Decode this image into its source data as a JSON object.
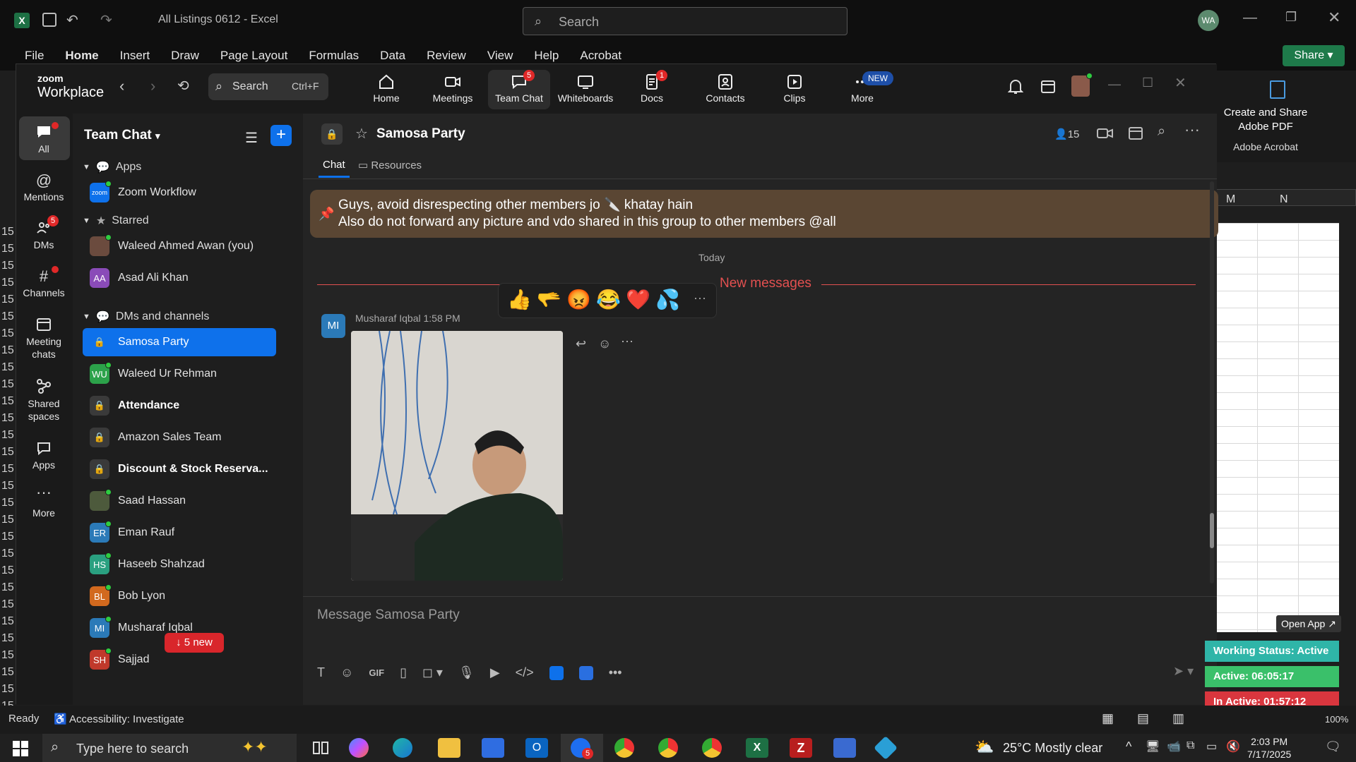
{
  "excel": {
    "title": "All Listings 0612 - Excel",
    "search_placeholder": "Search",
    "user_initials": "WA",
    "tabs": [
      "File",
      "Home",
      "Insert",
      "Draw",
      "Page Layout",
      "Formulas",
      "Data",
      "Review",
      "View",
      "Help",
      "Acrobat"
    ],
    "share_label": "Share",
    "acrobat_create": "Create and Share Adobe PDF",
    "acrobat_group": "Adobe Acrobat",
    "columns": [
      "M",
      "N"
    ],
    "row_prefix": "15",
    "status_ready": "Ready",
    "accessibility": "Accessibility: Investigate",
    "zoom_level": "100%",
    "open_app": "Open App ↗",
    "working_status": "Working Status: Active",
    "active_time": "Active: 06:05:17",
    "inactive_time": "In Active: 01:57:12"
  },
  "zoom": {
    "logo_top": "zoom",
    "logo_bottom": "Workplace",
    "search_label": "Search",
    "search_shortcut": "Ctrl+F",
    "top_tabs": [
      {
        "label": "Home",
        "icon": "home-icon"
      },
      {
        "label": "Meetings",
        "icon": "video-icon"
      },
      {
        "label": "Team Chat",
        "icon": "chat-icon",
        "badge": "5"
      },
      {
        "label": "Whiteboards",
        "icon": "whiteboard-icon"
      },
      {
        "label": "Docs",
        "icon": "docs-icon",
        "badge": "1"
      },
      {
        "label": "Contacts",
        "icon": "contacts-icon"
      },
      {
        "label": "Clips",
        "icon": "clips-icon"
      },
      {
        "label": "More",
        "icon": "more-icon",
        "badge_new": "NEW"
      }
    ],
    "rail": [
      {
        "label": "All",
        "icon": "chat-bubble-icon"
      },
      {
        "label": "Mentions",
        "icon": "at-icon"
      },
      {
        "label": "DMs",
        "icon": "people-icon",
        "badge": "5"
      },
      {
        "label": "Channels",
        "icon": "hash-icon"
      },
      {
        "label": "Meeting chats",
        "icon": "calendar-icon"
      },
      {
        "label": "Shared spaces",
        "icon": "share-icon"
      },
      {
        "label": "Apps",
        "icon": "apps-icon"
      },
      {
        "label": "More",
        "icon": "more-dots-icon"
      }
    ],
    "list_title": "Team Chat",
    "sections": {
      "apps": "Apps",
      "starred": "Starred",
      "dms": "DMs and channels"
    },
    "apps_items": [
      {
        "name": "Zoom Workflow",
        "initials": "zoom"
      }
    ],
    "starred_items": [
      {
        "name": "Waleed Ahmed Awan (you)",
        "initials": "",
        "color": "#6b4b3e"
      },
      {
        "name": "Asad Ali Khan",
        "initials": "AA",
        "color": "#8a4bb8"
      }
    ],
    "dm_items": [
      {
        "name": "Samosa Party",
        "initials": "",
        "type": "lock",
        "selected": true
      },
      {
        "name": "Waleed Ur Rehman",
        "initials": "WU",
        "color": "#2ca24a"
      },
      {
        "name": "Attendance",
        "initials": "",
        "type": "lock",
        "bold": true
      },
      {
        "name": "Amazon Sales Team",
        "initials": "",
        "type": "lock"
      },
      {
        "name": "Discount & Stock Reserva...",
        "initials": "",
        "type": "lock",
        "bold": true
      },
      {
        "name": "Saad Hassan",
        "initials": "",
        "color": "#4d5a3c"
      },
      {
        "name": "Eman Rauf",
        "initials": "ER",
        "color": "#2b7ab8"
      },
      {
        "name": "Haseeb Shahzad",
        "initials": "HS",
        "color": "#2aa080"
      },
      {
        "name": "Bob Lyon",
        "initials": "BL",
        "color": "#d2691e"
      },
      {
        "name": "Musharaf Iqbal",
        "initials": "MI",
        "color": "#2b7ab8"
      },
      {
        "name": "Sajjad",
        "initials": "SH",
        "color": "#c0392b"
      }
    ],
    "new_pill": "↓ 5 new",
    "channel": {
      "name": "Samosa Party",
      "member_count": "15",
      "tabs": [
        "Chat",
        "Resources"
      ],
      "pinned_line1": "Guys, avoid disrespecting other members jo 🔪 khatay hain",
      "pinned_line2": "Also do not forward any picture and vdo shared in this group to other members @all",
      "date_divider": "Today",
      "new_messages": "New messages",
      "message_sender": "Musharaf Iqbal",
      "message_time": "1:58 PM",
      "sender_initials": "MI",
      "reactions": [
        "👍",
        "🫳",
        "😡",
        "😂",
        "❤️",
        "💦"
      ],
      "composer_placeholder": "Message Samosa Party"
    }
  },
  "taskbar": {
    "search_placeholder": "Type here to search",
    "weather": "25°C  Mostly clear",
    "time": "2:03 PM",
    "date": "7/17/2025",
    "zoom_badge": "5"
  }
}
